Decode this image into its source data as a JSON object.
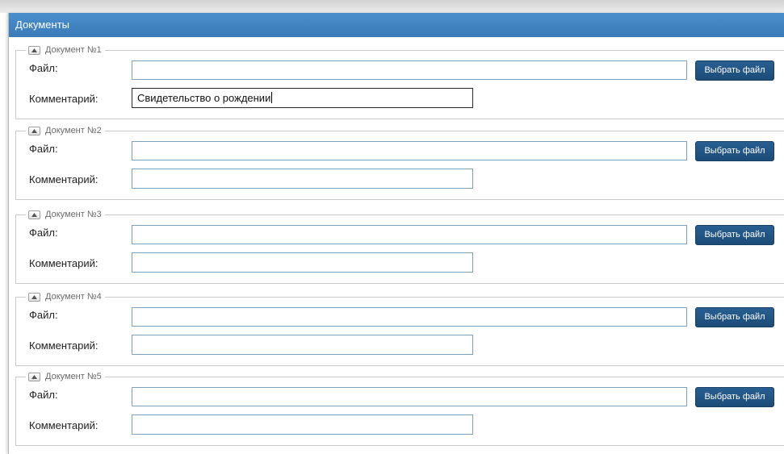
{
  "panel": {
    "title": "Документы"
  },
  "labels": {
    "file": "Файл:",
    "comment": "Комментарий:",
    "choose_file": "Выбрать файл"
  },
  "documents": [
    {
      "legend": "Документ №1",
      "file_value": "",
      "comment_value": "Свидетельство о рождении"
    },
    {
      "legend": "Документ №2",
      "file_value": "",
      "comment_value": ""
    },
    {
      "legend": "Документ №3",
      "file_value": "",
      "comment_value": ""
    },
    {
      "legend": "Документ №4",
      "file_value": "",
      "comment_value": ""
    },
    {
      "legend": "Документ №5",
      "file_value": "",
      "comment_value": ""
    }
  ],
  "colors": {
    "header": "#3f82c0",
    "button": "#22558a",
    "input_border": "#7ca0c0"
  },
  "icons": {
    "collapse": "collapse-up-icon"
  }
}
